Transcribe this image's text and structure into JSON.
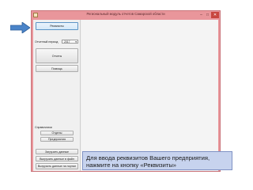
{
  "window": {
    "title": "Региональный модуль отчетов Самарской области",
    "min_glyph": "–",
    "max_glyph": "□",
    "close_glyph": "✕"
  },
  "left_panel": {
    "requisites_button": "Реквизиты",
    "period_label": "Отчетный период",
    "period_value": "2017",
    "reports_button": "Отчеты",
    "help_button": "Помощь",
    "reference_section_label": "Справочники",
    "departments_button": "Отделы",
    "enterprises_button": "Предприятия",
    "load_data_button": "Загрузить данные",
    "export_file_button": "Выгрузить данные в файл",
    "export_portal_button": "Выгрузить данные на портал"
  },
  "tooltip": {
    "line1": "Для ввода реквизитов Вашего предприятия,",
    "line2": "нажмите на кнопку «Реквизиты»"
  },
  "colors": {
    "arrow": "#4a84c9",
    "window_frame": "#e9969b",
    "close_button": "#c7463f",
    "tooltip_bg": "#c7d3ee",
    "active_button_border": "#5b94c5"
  },
  "icons": {
    "pointer_arrow": "arrow-right-icon",
    "app": "app-icon",
    "dropdown": "chevron-down-icon"
  }
}
